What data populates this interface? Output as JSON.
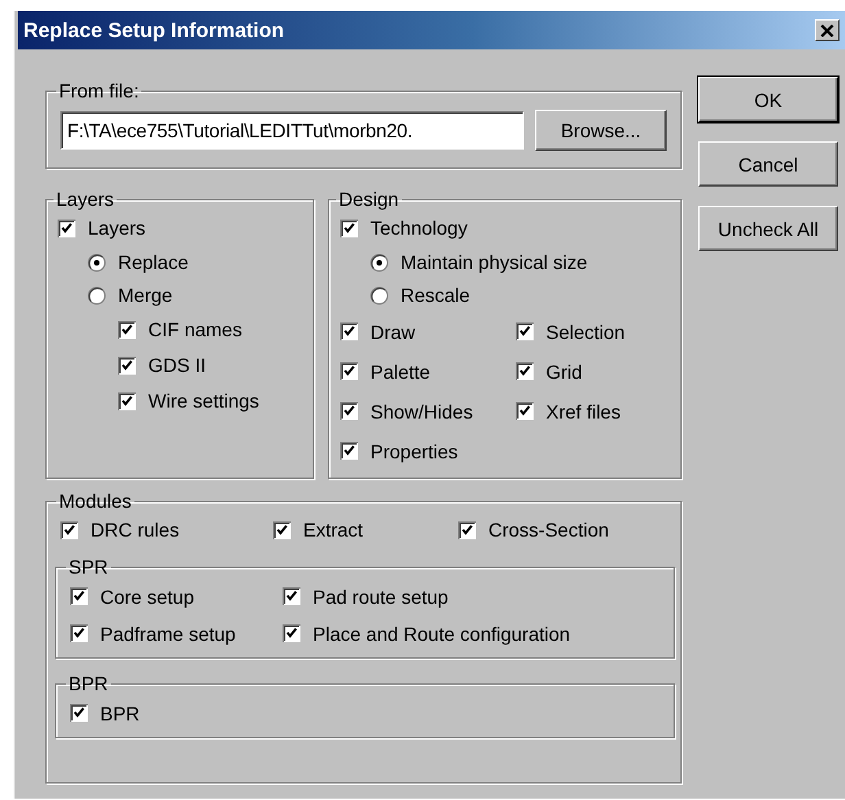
{
  "window": {
    "title": "Replace Setup Information"
  },
  "from_file": {
    "label": "From file:",
    "value": "F:\\TA\\ece755\\Tutorial\\LEDITTut\\morbn20.",
    "browse_button": "Browse..."
  },
  "buttons": [
    {
      "label": "OK",
      "default": true
    },
    {
      "label": "Cancel",
      "default": false
    },
    {
      "label": "Uncheck All",
      "default": false
    }
  ],
  "layers": {
    "label": "Layers",
    "items": [
      {
        "kind": "check",
        "label": "Layers",
        "checked": true,
        "children": [
          {
            "kind": "radio",
            "label": "Replace",
            "selected": true
          },
          {
            "kind": "radio",
            "label": "Merge",
            "selected": false,
            "children": [
              {
                "kind": "check",
                "label": "CIF names",
                "checked": true
              },
              {
                "kind": "check",
                "label": "GDS II",
                "checked": true
              },
              {
                "kind": "check",
                "label": "Wire settings",
                "checked": true
              }
            ]
          }
        ]
      }
    ]
  },
  "design": {
    "label": "Design",
    "items": [
      {
        "kind": "check",
        "label": "Technology",
        "checked": true,
        "children": [
          {
            "kind": "radio",
            "label": "Maintain physical size",
            "selected": true
          },
          {
            "kind": "radio",
            "label": "Rescale",
            "selected": false
          }
        ]
      }
    ],
    "options": [
      {
        "kind": "check",
        "label": "Draw",
        "checked": true
      },
      {
        "kind": "check",
        "label": "Selection",
        "checked": true
      },
      {
        "kind": "check",
        "label": "Palette",
        "checked": true
      },
      {
        "kind": "check",
        "label": "Grid",
        "checked": true
      },
      {
        "kind": "check",
        "label": "Show/Hides",
        "checked": true
      },
      {
        "kind": "check",
        "label": "Xref files",
        "checked": true
      },
      {
        "kind": "check",
        "label": "Properties",
        "checked": true
      }
    ]
  },
  "modules": {
    "label": "Modules",
    "items": [
      {
        "kind": "check",
        "label": "DRC rules",
        "checked": true
      },
      {
        "kind": "check",
        "label": "Extract",
        "checked": true
      },
      {
        "kind": "check",
        "label": "Cross-Section",
        "checked": true
      }
    ],
    "groups": [
      {
        "label": "SPR",
        "items": [
          {
            "kind": "check",
            "label": "Core setup",
            "checked": true
          },
          {
            "kind": "check",
            "label": "Pad route setup",
            "checked": true
          },
          {
            "kind": "check",
            "label": "Padframe setup",
            "checked": true
          },
          {
            "kind": "check",
            "label": "Place and Route configuration",
            "checked": true
          }
        ]
      },
      {
        "label": "BPR",
        "items": [
          {
            "kind": "check",
            "label": "BPR",
            "checked": true
          }
        ]
      }
    ]
  }
}
